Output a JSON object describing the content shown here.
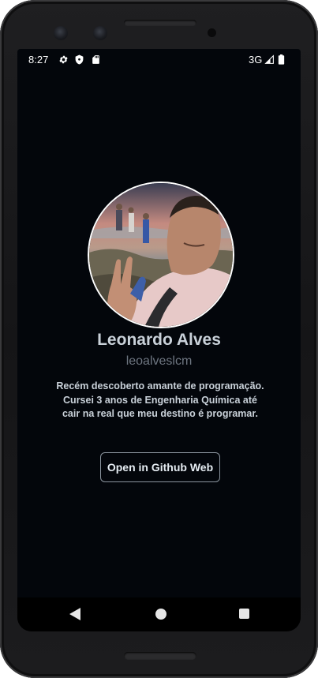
{
  "status_bar": {
    "time": "8:27",
    "network": "3G",
    "icons": [
      "gear-icon",
      "shield-icon",
      "sd-card-icon",
      "signal-icon",
      "battery-icon"
    ]
  },
  "profile": {
    "name": "Leonardo Alves",
    "username": "leoalveslcm",
    "bio": "Recém descoberto amante de programação. Cursei 3 anos de Engenharia Química até cair na real que meu destino é programar.",
    "avatar": "profile-photo"
  },
  "actions": {
    "open_github_label": "Open in Github Web"
  },
  "nav_bar": {
    "icons": [
      "back-icon",
      "home-icon",
      "recents-icon"
    ]
  },
  "colors": {
    "background": "#03060b",
    "name_text": "#c9d1d9",
    "username_text": "#6e7681",
    "button_border": "#8b949e"
  }
}
